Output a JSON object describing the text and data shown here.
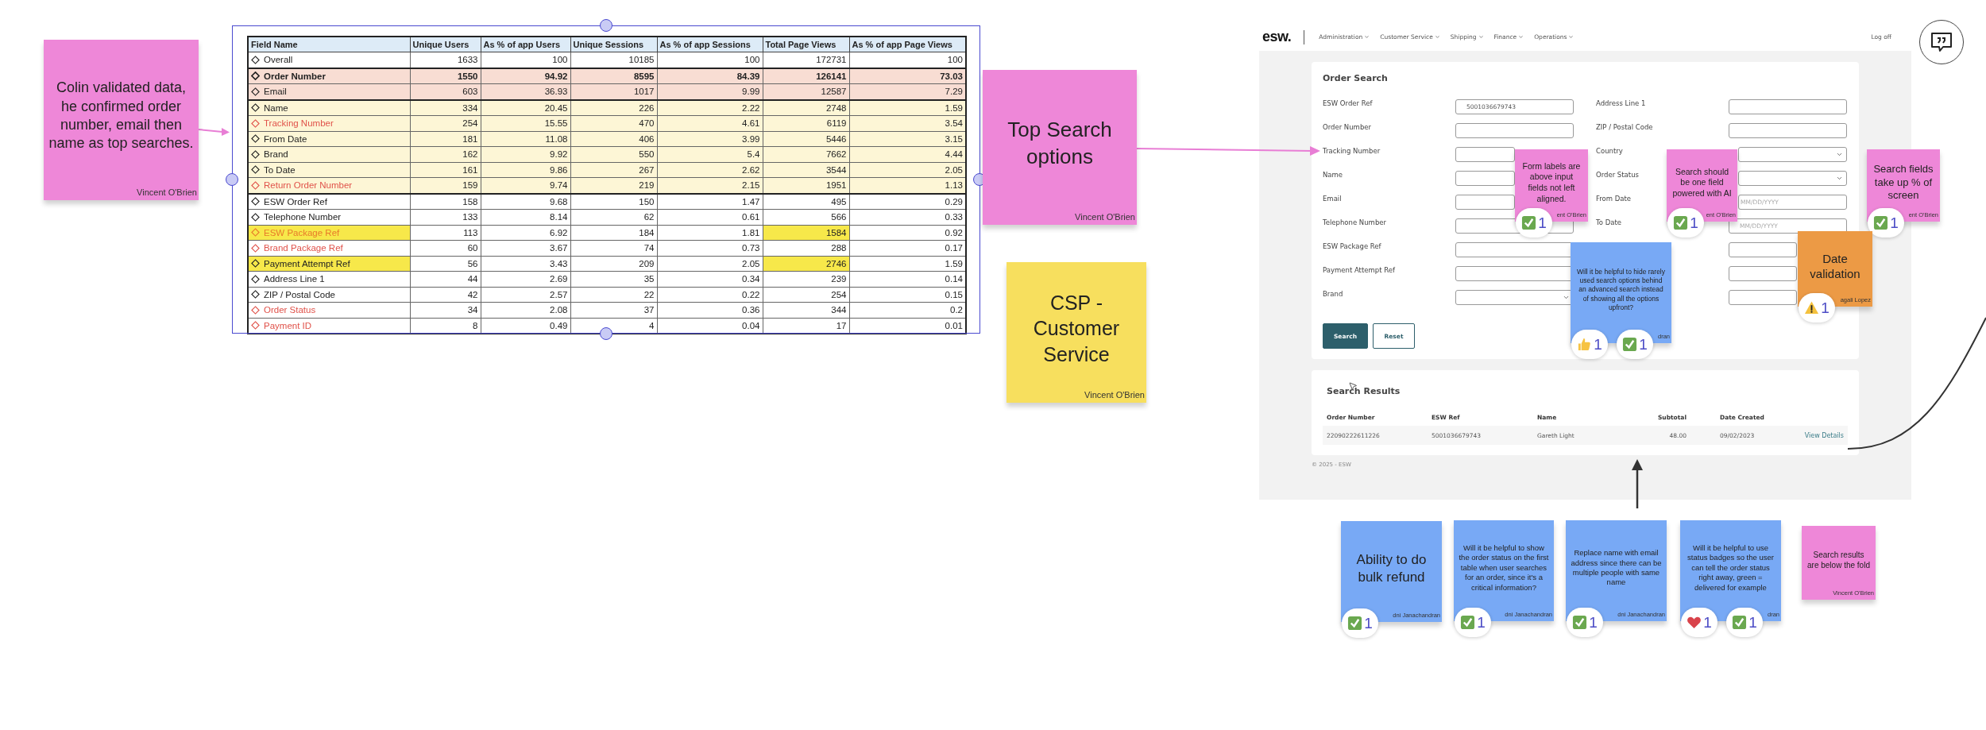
{
  "data_table": {
    "columns": [
      "Field Name",
      "Unique Users",
      "As % of app Users",
      "Unique Sessions",
      "As % of app Sessions",
      "Total Page Views",
      "As % of app Page Views"
    ],
    "rows": [
      {
        "kind": "plain",
        "bold": false,
        "color": "#222222",
        "name_marked": false,
        "views_marked": false,
        "cells": [
          "Overall",
          "1633",
          "100",
          "10185",
          "100",
          "172731",
          "100"
        ]
      },
      {
        "kind": "peach",
        "bold": true,
        "color": "#222222",
        "name_marked": false,
        "views_marked": false,
        "cells": [
          "Order Number",
          "1550",
          "94.92",
          "8595",
          "84.39",
          "126141",
          "73.03"
        ]
      },
      {
        "kind": "peach",
        "bold": false,
        "color": "#222222",
        "name_marked": false,
        "views_marked": false,
        "cells": [
          "Email",
          "603",
          "36.93",
          "1017",
          "9.99",
          "12587",
          "7.29"
        ]
      },
      {
        "kind": "cream",
        "bold": false,
        "color": "#222222",
        "name_marked": false,
        "views_marked": false,
        "cells": [
          "Name",
          "334",
          "20.45",
          "226",
          "2.22",
          "2748",
          "1.59"
        ]
      },
      {
        "kind": "cream",
        "bold": false,
        "color": "#e0524a",
        "name_marked": false,
        "views_marked": false,
        "cells": [
          "Tracking Number",
          "254",
          "15.55",
          "470",
          "4.61",
          "6119",
          "3.54"
        ]
      },
      {
        "kind": "cream",
        "bold": false,
        "color": "#222222",
        "name_marked": false,
        "views_marked": false,
        "cells": [
          "From Date",
          "181",
          "11.08",
          "406",
          "3.99",
          "5446",
          "3.15"
        ]
      },
      {
        "kind": "cream",
        "bold": false,
        "color": "#222222",
        "name_marked": false,
        "views_marked": false,
        "cells": [
          "Brand",
          "162",
          "9.92",
          "550",
          "5.4",
          "7662",
          "4.44"
        ]
      },
      {
        "kind": "cream",
        "bold": false,
        "color": "#222222",
        "name_marked": false,
        "views_marked": false,
        "cells": [
          "To Date",
          "161",
          "9.86",
          "267",
          "2.62",
          "3544",
          "2.05"
        ]
      },
      {
        "kind": "cream",
        "bold": false,
        "color": "#e0524a",
        "name_marked": false,
        "views_marked": false,
        "cells": [
          "Return Order Number",
          "159",
          "9.74",
          "219",
          "2.15",
          "1951",
          "1.13"
        ]
      },
      {
        "kind": "plain",
        "bold": false,
        "color": "#222222",
        "name_marked": false,
        "views_marked": false,
        "cells": [
          "ESW Order Ref",
          "158",
          "9.68",
          "150",
          "1.47",
          "495",
          "0.29"
        ]
      },
      {
        "kind": "plain",
        "bold": false,
        "color": "#222222",
        "name_marked": false,
        "views_marked": false,
        "cells": [
          "Telephone Number",
          "133",
          "8.14",
          "62",
          "0.61",
          "566",
          "0.33"
        ]
      },
      {
        "kind": "plain",
        "bold": false,
        "color": "#e87a2a",
        "name_marked": true,
        "views_marked": true,
        "cells": [
          "ESW Package Ref",
          "113",
          "6.92",
          "184",
          "1.81",
          "1584",
          "0.92"
        ]
      },
      {
        "kind": "plain",
        "bold": false,
        "color": "#e0524a",
        "name_marked": false,
        "views_marked": false,
        "cells": [
          "Brand Package Ref",
          "60",
          "3.67",
          "74",
          "0.73",
          "288",
          "0.17"
        ]
      },
      {
        "kind": "plain",
        "bold": false,
        "color": "#222222",
        "name_marked": true,
        "views_marked": true,
        "cells": [
          "Payment Attempt Ref",
          "56",
          "3.43",
          "209",
          "2.05",
          "2746",
          "1.59"
        ]
      },
      {
        "kind": "plain",
        "bold": false,
        "color": "#222222",
        "name_marked": false,
        "views_marked": false,
        "cells": [
          "Address Line 1",
          "44",
          "2.69",
          "35",
          "0.34",
          "239",
          "0.14"
        ]
      },
      {
        "kind": "plain",
        "bold": false,
        "color": "#222222",
        "name_marked": false,
        "views_marked": false,
        "cells": [
          "ZIP / Postal Code",
          "42",
          "2.57",
          "22",
          "0.22",
          "254",
          "0.15"
        ]
      },
      {
        "kind": "plain",
        "bold": false,
        "color": "#e0524a",
        "name_marked": false,
        "views_marked": false,
        "cells": [
          "Order Status",
          "34",
          "2.08",
          "37",
          "0.36",
          "344",
          "0.2"
        ]
      },
      {
        "kind": "plain",
        "bold": false,
        "color": "#e0524a",
        "name_marked": false,
        "views_marked": false,
        "cells": [
          "Payment ID",
          "8",
          "0.49",
          "4",
          "0.04",
          "17",
          "0.01"
        ]
      }
    ]
  },
  "app": {
    "logo": "esw.",
    "menu": [
      "Administration",
      "Customer Service",
      "Shipping",
      "Finance",
      "Operations"
    ],
    "logoff": "Log off",
    "order_search": {
      "title": "Order Search",
      "left_fields": [
        {
          "kind": "text",
          "label": "ESW Order Ref",
          "value": "5001036679743"
        },
        {
          "kind": "text",
          "label": "Order Number"
        },
        {
          "kind": "text",
          "label": "Tracking Number"
        },
        {
          "kind": "text",
          "label": "Name"
        },
        {
          "kind": "text",
          "label": "Email"
        },
        {
          "kind": "text",
          "label": "Telephone Number"
        },
        {
          "kind": "text",
          "label": "ESW Package Ref"
        },
        {
          "kind": "text",
          "label": "Payment Attempt Ref"
        },
        {
          "kind": "select",
          "label": "Brand"
        }
      ],
      "right_fields": [
        {
          "kind": "text",
          "label": "Address Line 1"
        },
        {
          "kind": "text",
          "label": "ZIP / Postal Code"
        },
        {
          "kind": "select",
          "label": "Country"
        },
        {
          "kind": "select",
          "label": "Order Status"
        },
        {
          "kind": "text",
          "label": "From Date",
          "placeholder": "MM/DD/YYYY"
        },
        {
          "kind": "text",
          "label": "To Date",
          "placeholder": "MM/DD/YYYY"
        },
        {
          "kind": "text"
        },
        {
          "kind": "text"
        },
        {
          "kind": "text"
        }
      ],
      "buttons": [
        "Search",
        "Reset"
      ]
    },
    "search_results": {
      "title": "Search Results",
      "columns": [
        "Order Number",
        "ESW Ref",
        "Name",
        "Subtotal",
        "Date Created"
      ],
      "rows": [
        {
          "cells": [
            "22090222611226",
            "5001036679743",
            "Gareth Light",
            "48.00",
            "09/02/2023"
          ],
          "action": "View Details"
        }
      ]
    },
    "footer": "© 2025 - ESW"
  },
  "stickies": [
    {
      "color": "#ee87d8",
      "text": "Colin validated data, he confirmed order number, email then name as top searches.",
      "author": "Vincent O'Brien"
    },
    {
      "color": "#ee87d8",
      "text": "Top Search options",
      "author": "Vincent O'Brien"
    },
    {
      "color": "#f7df5e",
      "text": "CSP - Customer Service",
      "author": "Vincent O'Brien"
    },
    {
      "color": "#ee87d8",
      "text": "Form labels are above input fields not left aligned.",
      "author": "ent O'Brien",
      "reactions": [
        {
          "kind": "check",
          "count": "1"
        }
      ]
    },
    {
      "color": "#ee87d8",
      "text": "Search should be one field powered with AI",
      "author": "ent O'Brien",
      "reactions": [
        {
          "kind": "check",
          "count": "1"
        }
      ]
    },
    {
      "color": "#ee87d8",
      "text": "Search fields take up % of screen",
      "author": "ent O'Brien",
      "reactions": [
        {
          "kind": "check",
          "count": "1"
        }
      ]
    },
    {
      "color": "#78a9f5",
      "text": "Will it be helpful to hide rarely used search options behind an advanced search instead of showing all the options upfront?",
      "author": "dran",
      "reactions": [
        {
          "kind": "thumbs",
          "count": "1"
        },
        {
          "kind": "check",
          "count": "1"
        }
      ]
    },
    {
      "color": "#ec9a45",
      "text": "Date validation",
      "author": "agali Lopez",
      "reactions": [
        {
          "kind": "warning",
          "count": "1"
        }
      ]
    },
    {
      "color": "#78a9f5",
      "text": "Ability to do bulk refund",
      "author": "dni Janachandran",
      "reactions": [
        {
          "kind": "check",
          "count": "1"
        }
      ]
    },
    {
      "color": "#78a9f5",
      "text": "Will it be helpful to show the order status on the first table when user searches for an order, since it's a critical information?",
      "author": "dni Janachandran",
      "reactions": [
        {
          "kind": "check",
          "count": "1"
        }
      ]
    },
    {
      "color": "#78a9f5",
      "text": "Replace name with email address since there can be multiple people with same name",
      "author": "dni Janachandran",
      "reactions": [
        {
          "kind": "check",
          "count": "1"
        }
      ]
    },
    {
      "color": "#78a9f5",
      "text": "Will it be helpful to use status badges so the user can tell the order status right away, green = delivered for example",
      "author": "dran",
      "reactions": [
        {
          "kind": "heart",
          "count": "1"
        },
        {
          "kind": "check",
          "count": "1"
        }
      ]
    },
    {
      "color": "#ee87d8",
      "text": "Search results are below the fold",
      "author": "Vincent O'Brien"
    }
  ]
}
